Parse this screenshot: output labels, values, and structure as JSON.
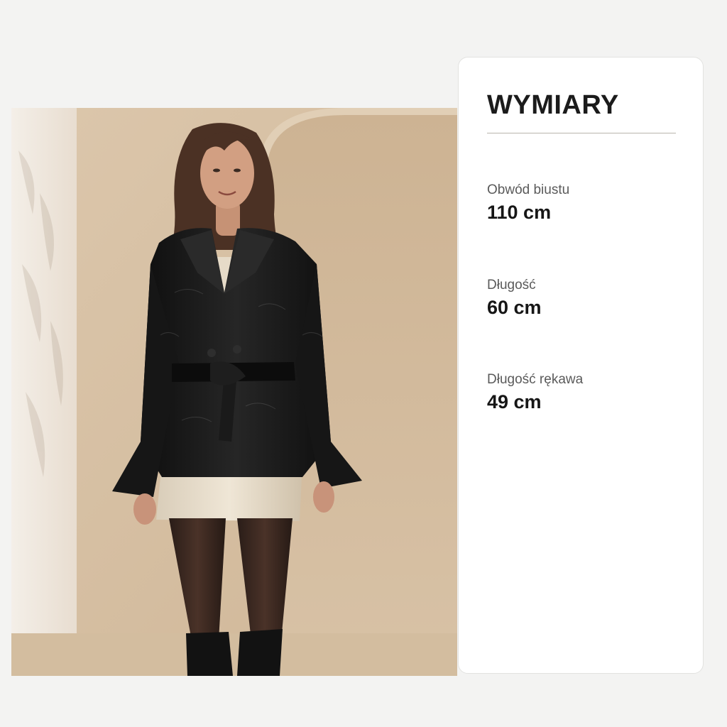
{
  "photo": {
    "alt": "Model wearing a black belted faux-leather jacket, champagne satin slip skirt, black sheer tights and black knee-high boots in front of a beige arched wall"
  },
  "dimensions": {
    "title": "WYMIARY",
    "items": [
      {
        "label": "Obwód biustu",
        "value": "110 cm"
      },
      {
        "label": "Długość",
        "value": "60 cm"
      },
      {
        "label": "Długość rękawa",
        "value": "49 cm"
      }
    ]
  },
  "colors": {
    "page_background": "#f3f3f2",
    "card_background": "#ffffff",
    "title_text": "#1b1b1b",
    "label_text": "#5a5a5a",
    "divider": "#b9b4ac",
    "wall_beige": "#d9c3a8",
    "jacket_black": "#141414"
  }
}
